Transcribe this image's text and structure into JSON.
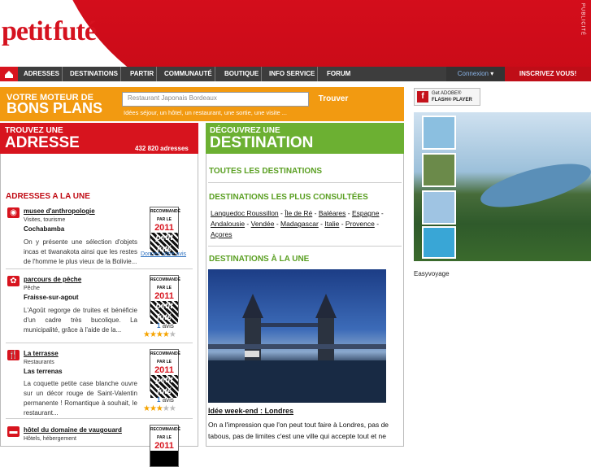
{
  "header": {
    "logo_word1": "petit",
    "logo_word2": "futé",
    "publicite": "PUBLICITÉ"
  },
  "nav": {
    "items": [
      "ADRESSES",
      "DESTINATIONS",
      "PARTIR",
      "COMMUNAUTÉ",
      "BOUTIQUE",
      "INFO SERVICE",
      "FORUM"
    ],
    "connexion": "Connexion",
    "inscrivez": "INSCRIVEZ VOUS!"
  },
  "search": {
    "line1": "VOTRE MOTEUR DE",
    "line2": "BONS PLANS",
    "placeholder": "Restaurant Japonais Bordeaux",
    "button": "Trouver",
    "sub": "Idées séjour, un hôtel, un restaurant, une sortie, une visite ..."
  },
  "left": {
    "head1": "TROUVEZ UNE",
    "head2": "ADRESSE",
    "count": "432 820 adresses",
    "une_title": "ADRESSES A LA UNE",
    "badge_top": "RECOMMANDÉ PAR LE",
    "badge_year": "2011",
    "badge_logo": "petit futé",
    "donnez": "Donnez votre avis",
    "entries": [
      {
        "name": "musee d'anthropologie",
        "cat": "Visites, tourisme",
        "city": "Cochabamba",
        "desc": "On y présente une sélection d'objets incas et tiwanakota ainsi que les restes de l'homme le plus vieux de la Bolivie..."
      },
      {
        "name": "parcours de pêche",
        "cat": "Pêche",
        "city": "Fraisse-sur-agout",
        "desc": "L'Agoût regorge de truites et bénéficie d'un cadre très bucolique. La municipalité, grâce à l'aide de la...",
        "avis_n": "1",
        "avis": "avis"
      },
      {
        "name": "La terrasse",
        "cat": "Restaurants",
        "city": "Las terrenas",
        "desc": "La coquette petite case blanche ouvre sur un décor rouge de Saint-Valentin permanente ! Romantique à souhait, le restaurant...",
        "avis_n": "1",
        "avis": "avis"
      },
      {
        "name": "hôtel du domaine de vaugouard",
        "cat": "Hôtels, hébergement"
      }
    ]
  },
  "mid": {
    "head1": "DÉCOUVREZ UNE",
    "head2": "DESTINATION",
    "toutes": "TOUTES LES DESTINATIONS",
    "plus": "DESTINATIONS LES PLUS CONSULTÉES",
    "links": [
      "Languedoc Roussillon",
      "Île de Ré",
      "Baléares",
      "Espagne",
      "Andalousie",
      "Vendée",
      "Madagascar",
      "Italie",
      "Provence",
      "Açores"
    ],
    "une": "DESTINATIONS À LA UNE",
    "photo_title": "Idée week-end : Londres",
    "photo_desc": "On a l'impression que l'on peut tout faire à Londres, pas de tabous, pas de limites c'est une ville qui accepte tout et ne"
  },
  "right": {
    "flash_line1": "Get ADOBE®",
    "flash_line2": "FLASH® PLAYER",
    "caption": "Easyvoyage"
  }
}
